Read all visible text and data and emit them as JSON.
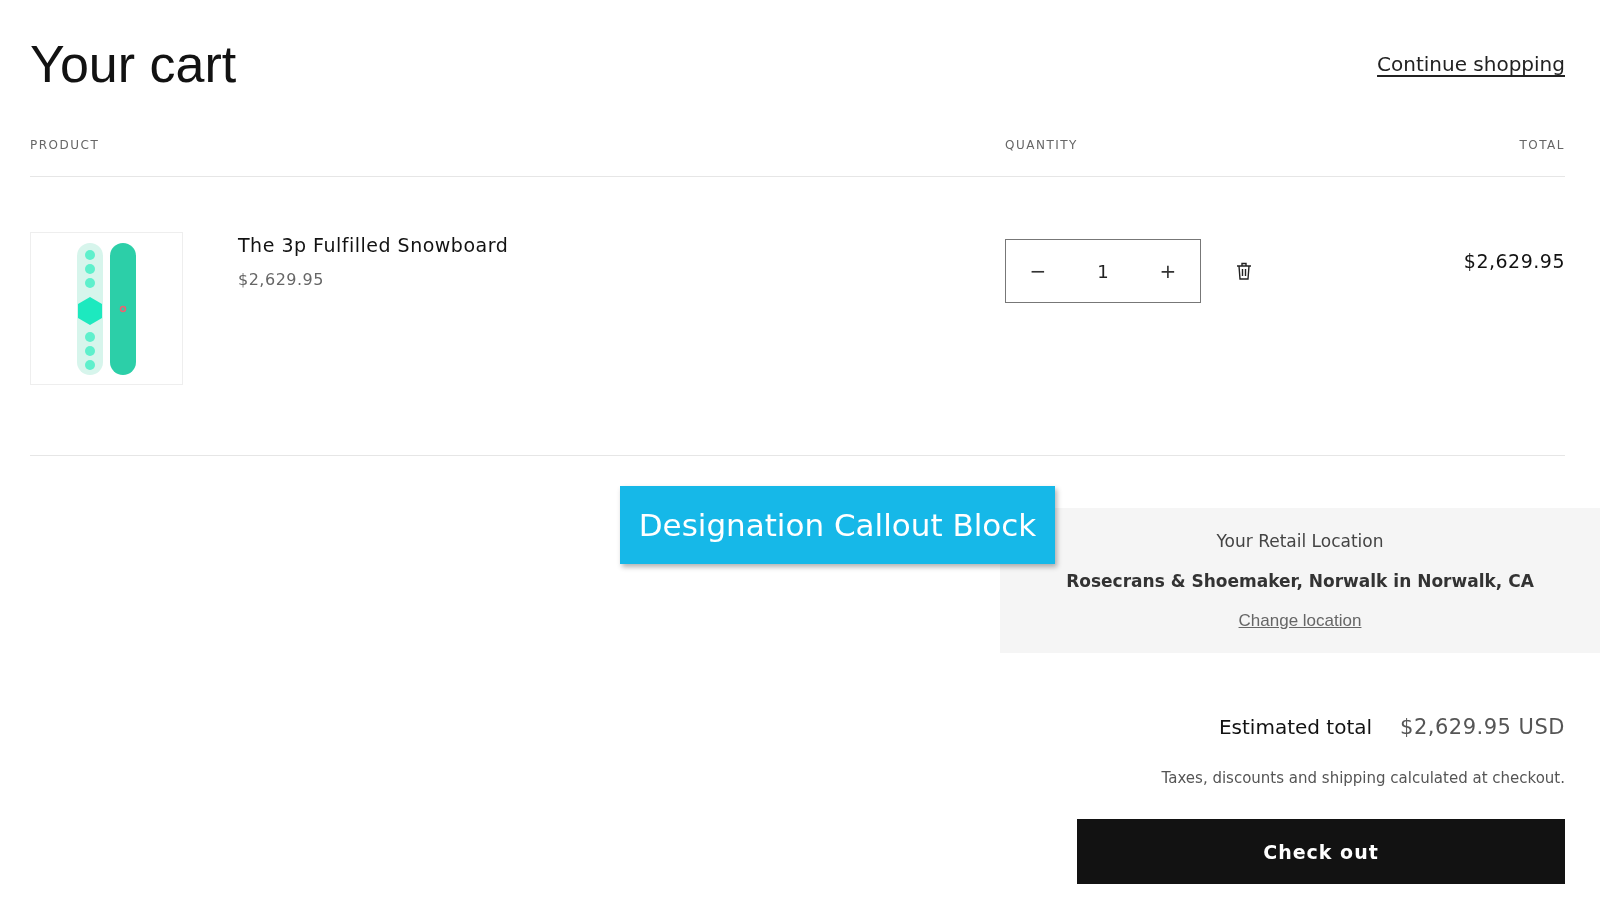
{
  "title": "Your cart",
  "continue_link": "Continue shopping",
  "columns": {
    "product": "PRODUCT",
    "quantity": "QUANTITY",
    "total": "TOTAL"
  },
  "items": [
    {
      "name": "The 3p Fulfilled Snowboard",
      "price": "$2,629.95",
      "quantity": "1",
      "decrease": "−",
      "increase": "+",
      "total": "$2,629.95"
    }
  ],
  "callout": "Designation Callout Block",
  "location": {
    "heading": "Your Retail Location",
    "store": "Rosecrans & Shoemaker, Norwalk in Norwalk, CA",
    "change_link": "Change location"
  },
  "summary": {
    "label": "Estimated total",
    "value": "$2,629.95 USD",
    "note": "Taxes, discounts and shipping calculated at checkout.",
    "checkout": "Check out"
  }
}
